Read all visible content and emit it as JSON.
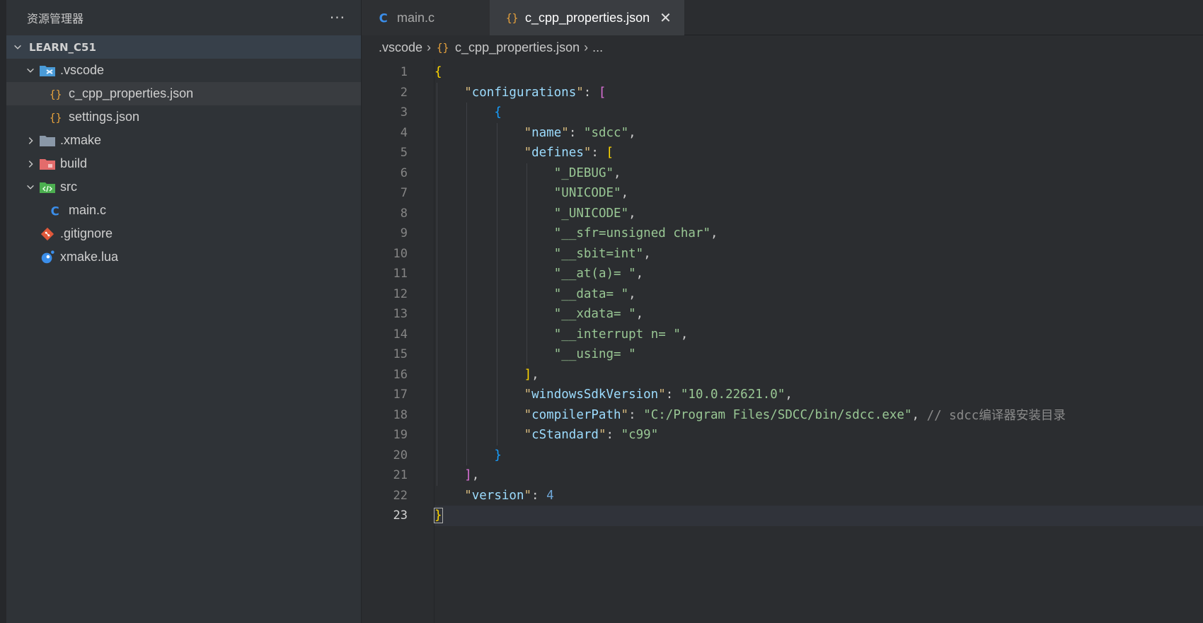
{
  "sidebar": {
    "title": "资源管理器",
    "more": "···",
    "project": "LEARN_C51",
    "items": [
      {
        "label": ".vscode"
      },
      {
        "label": "c_cpp_properties.json"
      },
      {
        "label": "settings.json"
      },
      {
        "label": ".xmake"
      },
      {
        "label": "build"
      },
      {
        "label": "src"
      },
      {
        "label": "main.c"
      },
      {
        "label": ".gitignore"
      },
      {
        "label": "xmake.lua"
      }
    ]
  },
  "tabs": [
    {
      "label": "main.c",
      "icon": "c-file-icon"
    },
    {
      "label": "c_cpp_properties.json",
      "icon": "json-braces-icon",
      "close": "✕"
    }
  ],
  "breadcrumb": [
    ".vscode",
    "c_cpp_properties.json",
    "..."
  ],
  "breadcrumb_sep": "›",
  "editor": {
    "current_line": 23,
    "line_numbers": [
      "1",
      "2",
      "3",
      "4",
      "5",
      "6",
      "7",
      "8",
      "9",
      "10",
      "11",
      "12",
      "13",
      "14",
      "15",
      "16",
      "17",
      "18",
      "19",
      "20",
      "21",
      "22",
      "23"
    ],
    "lines": [
      "{",
      "    \"configurations\": [",
      "        {",
      "            \"name\": \"sdcc\",",
      "            \"defines\": [",
      "                \"_DEBUG\",",
      "                \"UNICODE\",",
      "                \"_UNICODE\",",
      "                \"__sfr=unsigned char\",",
      "                \"__sbit=int\",",
      "                \"__at(a)= \",",
      "                \"__data= \",",
      "                \"__xdata= \",",
      "                \"__interrupt n= \",",
      "                \"__using= \"",
      "            ],",
      "            \"windowsSdkVersion\": \"10.0.22621.0\",",
      "            \"compilerPath\": \"C:/Program Files/SDCC/bin/sdcc.exe\", // sdcc编译器安装目录",
      "            \"cStandard\": \"c99\"",
      "        }",
      "    ],",
      "    \"version\": 4",
      "}"
    ]
  },
  "colors": {
    "accent_json": "#e8a33d",
    "accent_c": "#3b8eea",
    "string": "#99c794",
    "key": "#9cdcfe"
  }
}
